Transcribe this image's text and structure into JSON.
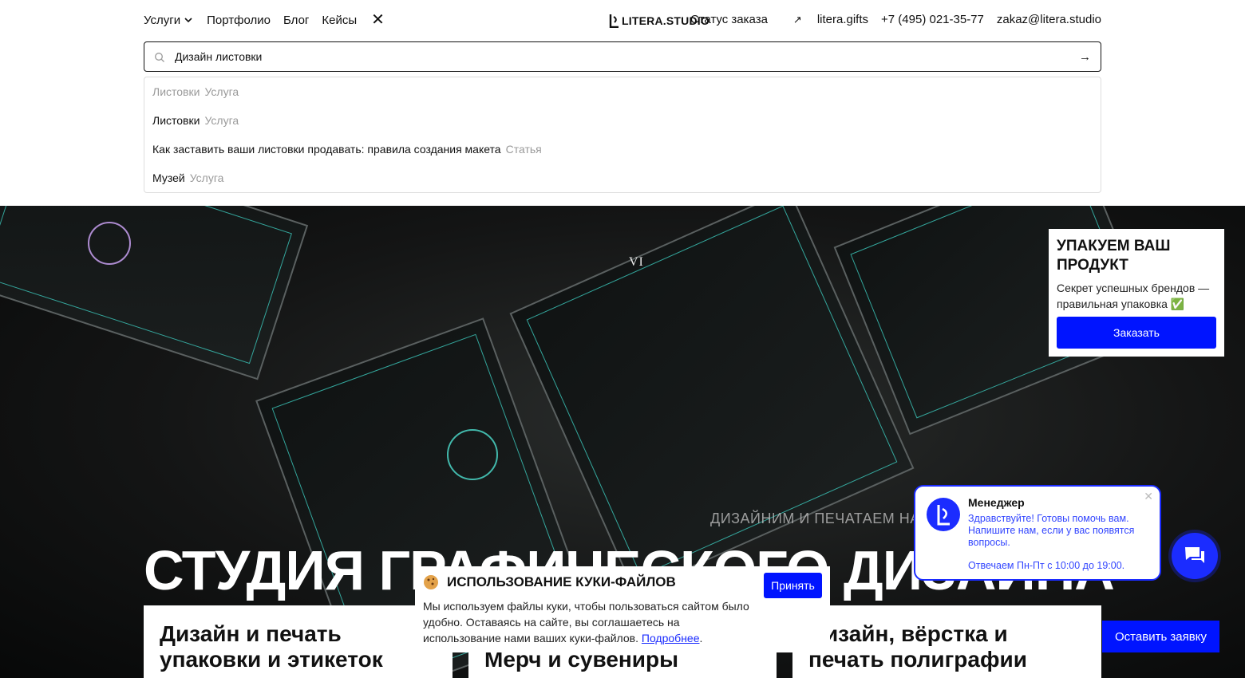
{
  "header": {
    "nav_left": [
      "Услуги",
      "Портфолио",
      "Блог",
      "Кейсы"
    ],
    "logo_text": "LITERA.STUDIO",
    "nav_right": {
      "order_status": "Статус заказа",
      "gifts": "litera.gifts",
      "phone": "+7 (495) 021-35-77",
      "email": "zakaz@litera.studio"
    }
  },
  "search": {
    "value": "Дизайн листовки",
    "suggestions": [
      {
        "title": "Листовки",
        "kind": "Услуга"
      },
      {
        "title": "Листовки",
        "kind": "Услуга"
      },
      {
        "title": "Как заставить ваши листовки продавать: правила создания макета",
        "kind": "Статья"
      },
      {
        "title": "Музей",
        "kind": "Услуга"
      }
    ]
  },
  "hero": {
    "title": "СТУДИЯ ГРАФИЧЕСКОГО ДИЗАЙНА",
    "chant": "ДИЗАЙНИМ И ПЕЧАТАЕМ НА",
    "card_numeral": "VI",
    "services": [
      "Дизайн и печать упаковки и этикеток",
      "Мерч и сувениры",
      "Дизайн, вёрстка и печать полиграфии"
    ]
  },
  "promo": {
    "title": "УПАКУЕМ ВАШ ПРОДУКТ",
    "text": "Секрет успешных брендов — правильная упаковка ✅",
    "button": "Заказать"
  },
  "chat": {
    "name": "Менеджер",
    "message": "Здравствуйте! Готовы помочь вам. Напишите нам, если у вас появятся вопросы.",
    "hours": "Отвечаем Пн-Пт с 10:00 до 19:00."
  },
  "cookie": {
    "title": "ИСПОЛЬЗОВАНИЕ КУКИ-ФАЙЛОВ",
    "text": "Мы используем файлы куки, чтобы пользоваться сайтом было удобно. Оставаясь на сайте, вы соглашаетесь на использование нами ваших куки-файлов.",
    "link": "Подробнее",
    "accept": "Принять"
  },
  "lead_button": "Оставить заявку",
  "colors": {
    "accent": "#0014ff",
    "chat_border": "#1b2cff"
  }
}
